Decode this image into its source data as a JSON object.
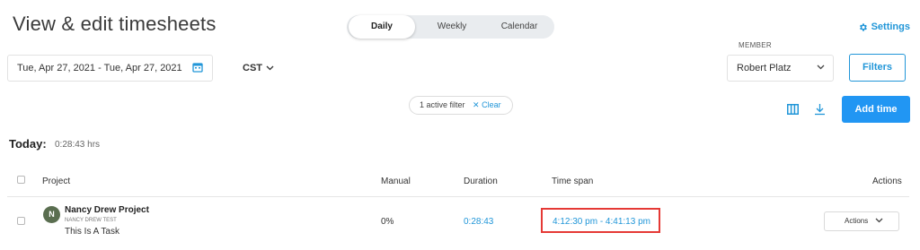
{
  "header": {
    "title": "View & edit timesheets",
    "settings_label": "Settings"
  },
  "view_toggle": {
    "daily": "Daily",
    "weekly": "Weekly",
    "calendar": "Calendar",
    "active": "Daily"
  },
  "date_range": {
    "value": "Tue, Apr 27, 2021 - Tue, Apr 27, 2021"
  },
  "timezone": {
    "value": "CST"
  },
  "member": {
    "label": "MEMBER",
    "value": "Robert Platz"
  },
  "filters_button": "Filters",
  "active_filter": {
    "text": "1 active filter",
    "clear_label": "Clear"
  },
  "add_time_button": "Add time",
  "summary": {
    "label": "Today:",
    "duration": "0:28:43 hrs"
  },
  "table": {
    "headers": {
      "project": "Project",
      "manual": "Manual",
      "duration": "Duration",
      "time_span": "Time span",
      "actions": "Actions"
    },
    "rows": [
      {
        "avatar_letter": "N",
        "project": "Nancy Drew Project",
        "client": "NANCY DREW TEST",
        "task": "This Is A Task",
        "manual": "0%",
        "duration": "0:28:43",
        "time_span": "4:12:30 pm - 4:41:13 pm",
        "actions_label": "Actions"
      }
    ]
  },
  "colors": {
    "accent": "#2196d8",
    "primary_button": "#2196f3",
    "highlight_box": "#e53935",
    "avatar": "#5a6e50"
  }
}
